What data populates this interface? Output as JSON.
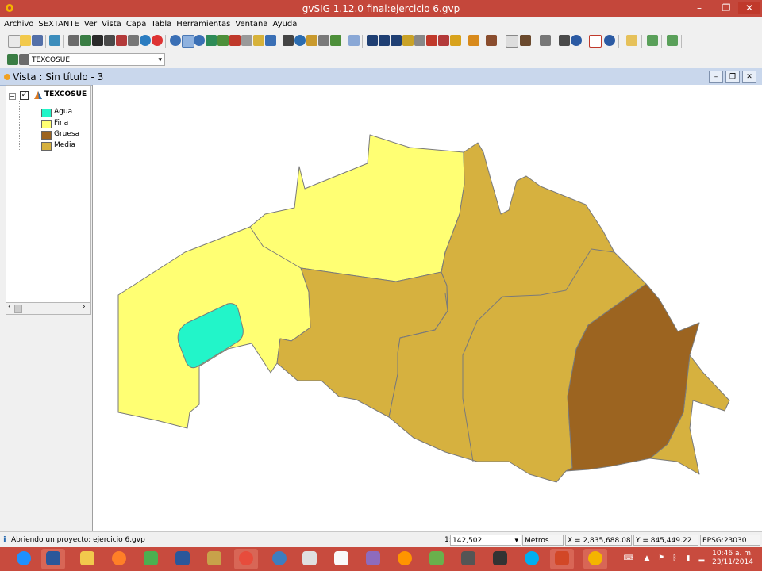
{
  "window": {
    "title": "gvSIG 1.12.0 final:ejercicio 6.gvp",
    "min_glyph": "–",
    "max_glyph": "❐",
    "close_glyph": "✕"
  },
  "menu": [
    "Archivo",
    "SEXTANTE",
    "Ver",
    "Vista",
    "Capa",
    "Tabla",
    "Herramientas",
    "Ventana",
    "Ayuda"
  ],
  "layer_selector": {
    "value": "TEXCOSUE"
  },
  "view": {
    "title": "Vista : Sin título - 3"
  },
  "toc": {
    "layer_name": "TEXCOSUE",
    "checked": true,
    "legend": [
      {
        "label": "Agua",
        "color": "#22f5c9"
      },
      {
        "label": "Fina",
        "color": "#ffff73"
      },
      {
        "label": "Gruesa",
        "color": "#9c6420"
      },
      {
        "label": "Media",
        "color": "#d6b13f"
      }
    ]
  },
  "status": {
    "message": "Abriendo un proyecto: ejercicio 6.gvp",
    "scale_prefix": "1:",
    "scale": "142,502",
    "units": "Metros",
    "x": "X = 2,835,688.08",
    "y": "Y = 845,449.22",
    "epsg": "EPSG:23030"
  },
  "taskbar": {
    "time": "10:46 a. m.",
    "date": "23/11/2014",
    "apps": [
      "ie",
      "word",
      "explorer",
      "orange-app",
      "w-app",
      "media",
      "package",
      "chrome",
      "search-app",
      "calc",
      "doc",
      "s-app",
      "firefox",
      "leaf-app",
      "tool",
      "dbase",
      "skype",
      "powerpoint",
      "gvsig"
    ]
  }
}
